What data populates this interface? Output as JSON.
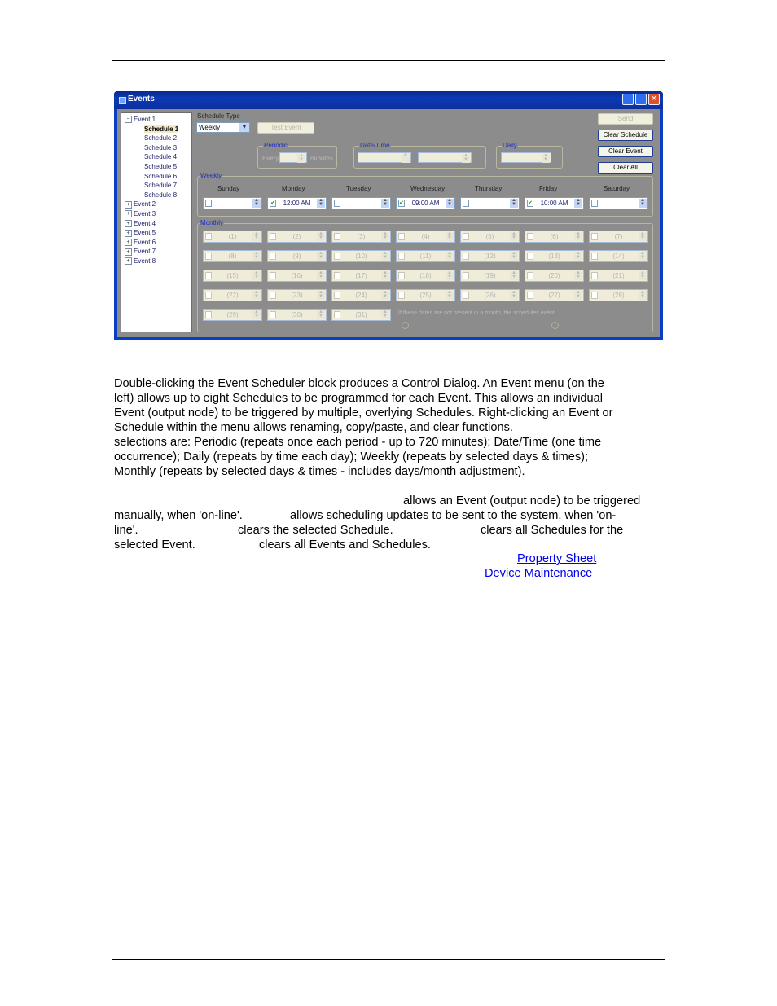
{
  "window": {
    "title": "Events",
    "buttons": {
      "minimize": "minimize",
      "maximize": "maximize",
      "close": "✕"
    }
  },
  "tree": {
    "events": [
      {
        "label": "Event 1",
        "expanded": true,
        "schedules": [
          "Schedule 1",
          "Schedule 2",
          "Schedule 3",
          "Schedule 4",
          "Schedule 5",
          "Schedule 6",
          "Schedule 7",
          "Schedule 8"
        ]
      },
      {
        "label": "Event 2"
      },
      {
        "label": "Event 3"
      },
      {
        "label": "Event 4"
      },
      {
        "label": "Event 5"
      },
      {
        "label": "Event 6"
      },
      {
        "label": "Event 7"
      },
      {
        "label": "Event 8"
      }
    ],
    "selected": "Schedule 1"
  },
  "schedule_type": {
    "label": "Schedule Type",
    "value": "Weekly"
  },
  "buttons": {
    "test_event": "Test Event",
    "send": "Send",
    "clear_schedule": "Clear Schedule",
    "clear_event": "Clear Event",
    "clear_all": "Clear All"
  },
  "periodic": {
    "title": "Periodic",
    "every": "Every",
    "minutes": "minutes"
  },
  "datetime": {
    "title": "Date/Time"
  },
  "daily": {
    "title": "Daily"
  },
  "weekly": {
    "title": "Weekly",
    "days": [
      {
        "name": "Sunday",
        "checked": false,
        "time": ""
      },
      {
        "name": "Monday",
        "checked": true,
        "time": "12:00 AM"
      },
      {
        "name": "Tuesday",
        "checked": false,
        "time": ""
      },
      {
        "name": "Wednesday",
        "checked": true,
        "time": "09:00 AM"
      },
      {
        "name": "Thursday",
        "checked": false,
        "time": ""
      },
      {
        "name": "Friday",
        "checked": true,
        "time": "10:00 AM"
      },
      {
        "name": "Saturday",
        "checked": false,
        "time": ""
      }
    ]
  },
  "monthly": {
    "title": "Monthly",
    "days": [
      "(1)",
      "(2)",
      "(3)",
      "(4)",
      "(5)",
      "(6)",
      "(7)",
      "(8)",
      "(9)",
      "(10)",
      "(11)",
      "(12)",
      "(13)",
      "(14)",
      "(15)",
      "(16)",
      "(17)",
      "(18)",
      "(19)",
      "(20)",
      "(21)",
      "(22)",
      "(23)",
      "(24)",
      "(25)",
      "(26)",
      "(27)",
      "(28)",
      "(29)",
      "(30)",
      "(31)"
    ],
    "note": "If these dates are not present in a month, the schedules event"
  },
  "doc": {
    "para1": [
      "Double-clicking the Event Scheduler block produces a Control Dialog. An Event menu (on the",
      "left) allows up to eight Schedules to be programmed for each Event. This allows an individual",
      "Event (output node) to be triggered by multiple, overlying Schedules. Right-clicking an Event or",
      "Schedule within the menu allows renaming, copy/paste, and clear functions.",
      "selections are: Periodic (repeats once each period - up to 720 minutes); Date/Time (one time",
      "occurrence); Daily (repeats by time each day); Weekly (repeats by selected days & times);",
      "Monthly (repeats by selected days & times - includes days/month adjustment)."
    ],
    "para2": {
      "l1": "allows an Event (output node) to be triggered",
      "l2a": "manually, when 'on-line'.",
      "l2b": "allows scheduling updates to be sent to the system, when 'on-",
      "l3a": "line'.",
      "l3b": "clears the selected Schedule.",
      "l3c": "clears all Schedules for the",
      "l4a": "selected Event.",
      "l4b": "clears all Events and Schedules."
    },
    "links": {
      "property_sheet": "Property Sheet",
      "device_maintenance": "Device Maintenance"
    }
  }
}
